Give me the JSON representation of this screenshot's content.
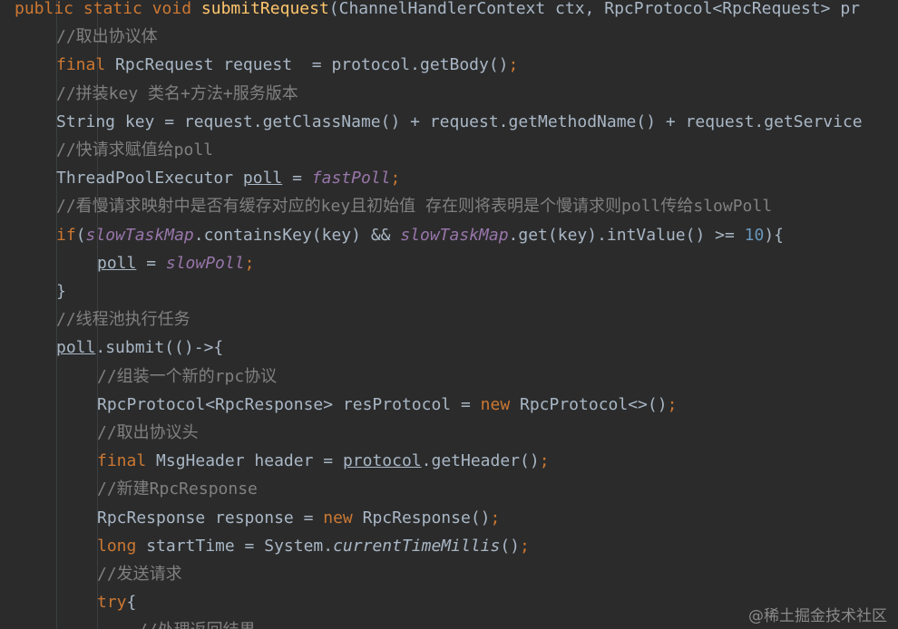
{
  "editor": {
    "lines": [
      {
        "indent": 0,
        "tokens": [
          {
            "t": "kw",
            "v": "public static void "
          },
          {
            "t": "mth",
            "v": "submitRequest"
          },
          {
            "t": "pl",
            "v": "(ChannelHandlerContext ctx, RpcProtocol<RpcRequest> pr"
          }
        ]
      },
      {
        "indent": 1,
        "tokens": [
          {
            "t": "com",
            "v": "//取出协议体"
          }
        ]
      },
      {
        "indent": 1,
        "tokens": [
          {
            "t": "kw",
            "v": "final "
          },
          {
            "t": "pl",
            "v": "RpcRequest request  = protocol.getBody()"
          },
          {
            "t": "kw",
            "v": ";"
          }
        ]
      },
      {
        "indent": 1,
        "tokens": [
          {
            "t": "com",
            "v": "//拼装key 类名+方法+服务版本"
          }
        ]
      },
      {
        "indent": 1,
        "tokens": [
          {
            "t": "pl",
            "v": "String key = request.getClassName() + request.getMethodName() + request.getService"
          }
        ]
      },
      {
        "indent": 1,
        "tokens": [
          {
            "t": "com",
            "v": "//快请求赋值给poll"
          }
        ]
      },
      {
        "indent": 1,
        "tokens": [
          {
            "t": "pl",
            "v": "ThreadPoolExecutor "
          },
          {
            "t": "var",
            "v": "poll"
          },
          {
            "t": "pl",
            "v": " = "
          },
          {
            "t": "fld",
            "v": "fastPoll"
          },
          {
            "t": "kw",
            "v": ";"
          }
        ]
      },
      {
        "indent": 1,
        "tokens": [
          {
            "t": "com",
            "v": "//看慢请求映射中是否有缓存对应的key且初始值 存在则将表明是个慢请求则poll传给slowPoll"
          }
        ]
      },
      {
        "indent": 1,
        "tokens": [
          {
            "t": "kw",
            "v": "if"
          },
          {
            "t": "pl",
            "v": "("
          },
          {
            "t": "fld",
            "v": "slowTaskMap"
          },
          {
            "t": "pl",
            "v": ".containsKey(key) && "
          },
          {
            "t": "fld",
            "v": "slowTaskMap"
          },
          {
            "t": "pl",
            "v": ".get(key).intValue() >= "
          },
          {
            "t": "num",
            "v": "10"
          },
          {
            "t": "pl",
            "v": "){"
          }
        ]
      },
      {
        "indent": 2,
        "tokens": [
          {
            "t": "var",
            "v": "poll"
          },
          {
            "t": "pl",
            "v": " = "
          },
          {
            "t": "fld",
            "v": "slowPoll"
          },
          {
            "t": "kw",
            "v": ";"
          }
        ]
      },
      {
        "indent": 1,
        "tokens": [
          {
            "t": "pl",
            "v": "}"
          }
        ]
      },
      {
        "indent": 1,
        "tokens": [
          {
            "t": "com",
            "v": "//线程池执行任务"
          }
        ]
      },
      {
        "indent": 1,
        "tokens": [
          {
            "t": "var",
            "v": "poll"
          },
          {
            "t": "pl",
            "v": ".submit(()->{"
          }
        ]
      },
      {
        "indent": 2,
        "tokens": [
          {
            "t": "com",
            "v": "//组装一个新的rpc协议"
          }
        ]
      },
      {
        "indent": 2,
        "tokens": [
          {
            "t": "pl",
            "v": "RpcProtocol<RpcResponse> resProtocol = "
          },
          {
            "t": "kw",
            "v": "new "
          },
          {
            "t": "pl",
            "v": "RpcProtocol<>()"
          },
          {
            "t": "kw",
            "v": ";"
          }
        ]
      },
      {
        "indent": 2,
        "tokens": [
          {
            "t": "com",
            "v": "//取出协议头"
          }
        ]
      },
      {
        "indent": 2,
        "tokens": [
          {
            "t": "kw",
            "v": "final "
          },
          {
            "t": "pl",
            "v": "MsgHeader header = "
          },
          {
            "t": "var",
            "v": "protocol"
          },
          {
            "t": "pl",
            "v": ".getHeader()"
          },
          {
            "t": "kw",
            "v": ";"
          }
        ]
      },
      {
        "indent": 2,
        "tokens": [
          {
            "t": "com",
            "v": "//新建RpcResponse"
          }
        ]
      },
      {
        "indent": 2,
        "tokens": [
          {
            "t": "pl",
            "v": "RpcResponse response = "
          },
          {
            "t": "kw",
            "v": "new "
          },
          {
            "t": "pl",
            "v": "RpcResponse()"
          },
          {
            "t": "kw",
            "v": ";"
          }
        ]
      },
      {
        "indent": 2,
        "tokens": [
          {
            "t": "kw",
            "v": "long "
          },
          {
            "t": "pl",
            "v": "startTime = System."
          },
          {
            "t": "it",
            "v": "currentTimeMillis"
          },
          {
            "t": "pl",
            "v": "()"
          },
          {
            "t": "kw",
            "v": ";"
          }
        ]
      },
      {
        "indent": 2,
        "tokens": [
          {
            "t": "com",
            "v": "//发送请求"
          }
        ]
      },
      {
        "indent": 2,
        "tokens": [
          {
            "t": "kw",
            "v": "try"
          },
          {
            "t": "pl",
            "v": "{"
          }
        ]
      },
      {
        "indent": 3,
        "tokens": [
          {
            "t": "com",
            "v": "//处理返回结果"
          }
        ]
      }
    ]
  },
  "watermark": "@稀土掘金技术社区"
}
